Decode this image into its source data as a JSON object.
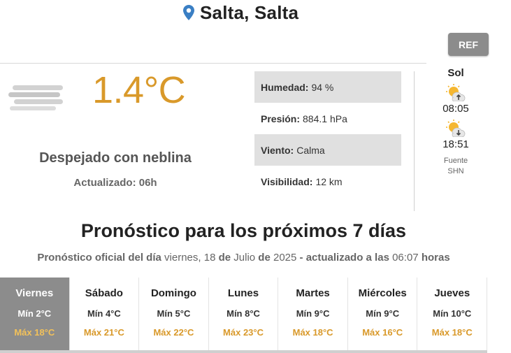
{
  "header": {
    "location": "Salta, Salta",
    "ref_label": "REF"
  },
  "current": {
    "icon": "fog-icon",
    "temperature": "1.4°C",
    "description": "Despejado con neblina",
    "updated": "Actualizado: 06h"
  },
  "details": [
    {
      "label": "Humedad:",
      "value": "94 %"
    },
    {
      "label": "Presión:",
      "value": "884.1 hPa"
    },
    {
      "label": "Viento:",
      "value": "Calma"
    },
    {
      "label": "Visibilidad:",
      "value": "12 km"
    }
  ],
  "sun": {
    "title": "Sol",
    "sunrise_icon": "sunrise-icon",
    "sunrise": "08:05",
    "sunset_icon": "sunset-icon",
    "sunset": "18:51",
    "source_label": "Fuente",
    "source": "SHN"
  },
  "forecast": {
    "title": "Pronóstico para los próximos 7 días",
    "subtitle": {
      "p1": "Pronóstico oficial del día",
      "p2": "viernes, 18",
      "p3": "de",
      "p4": "Julio",
      "p5": "de",
      "p6": "2025",
      "p7": "- actualizado a las",
      "p8": "06:07",
      "p9": "horas"
    },
    "days": [
      {
        "name": "Viernes",
        "min": "Mín 2°C",
        "max": "Máx 18°C"
      },
      {
        "name": "Sábado",
        "min": "Mín 4°C",
        "max": "Máx 21°C"
      },
      {
        "name": "Domingo",
        "min": "Mín 5°C",
        "max": "Máx 22°C"
      },
      {
        "name": "Lunes",
        "min": "Mín 8°C",
        "max": "Máx 23°C"
      },
      {
        "name": "Martes",
        "min": "Mín 9°C",
        "max": "Máx 18°C"
      },
      {
        "name": "Miércoles",
        "min": "Mín 9°C",
        "max": "Máx 16°C"
      },
      {
        "name": "Jueves",
        "min": "Mín 10°C",
        "max": "Máx 18°C"
      }
    ]
  },
  "colors": {
    "accent": "#d9992a",
    "pin": "#3a7fc4",
    "active_day": "#8c8c8c",
    "row_shade": "#e0e0e0"
  }
}
